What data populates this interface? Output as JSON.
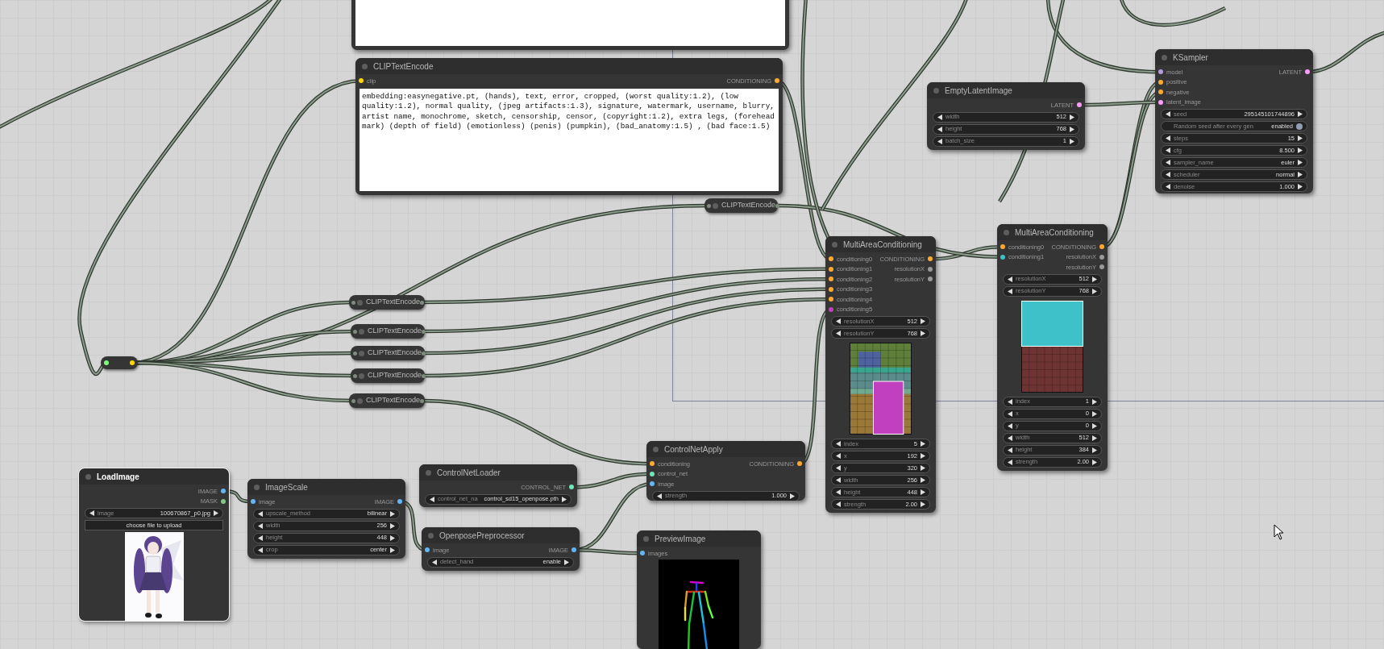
{
  "nodes": [
    {
      "kind": "node",
      "collapsed": false,
      "selected": false,
      "widgets": [
        {
          "kind": "text"
        }
      ]
    },
    {
      "kind": "node",
      "title": "KSampler",
      "collapsed": false,
      "selected": false,
      "inputs": [
        {
          "name": "model",
          "color": "#b39ddb"
        },
        {
          "name": "positive",
          "color": "#ffa931"
        },
        {
          "name": "negative",
          "color": "#ffa931"
        },
        {
          "name": "latent_image",
          "color": "#ff9cf9"
        }
      ],
      "outputs": [
        {
          "name": "LATENT",
          "color": "#ff9cf9"
        }
      ],
      "widgets": [
        {
          "kind": "value",
          "label": "seed",
          "value": "295145101744896"
        },
        {
          "kind": "toggle",
          "label": "Random seed after every gen",
          "value": "enabled",
          "on": true
        },
        {
          "kind": "value",
          "label": "steps",
          "value": "15"
        },
        {
          "kind": "value",
          "label": "cfg",
          "value": "8.500"
        },
        {
          "kind": "value",
          "label": "sampler_name",
          "value": "euler"
        },
        {
          "kind": "value",
          "label": "scheduler",
          "value": "normal"
        },
        {
          "kind": "value",
          "label": "denoise",
          "value": "1.000"
        }
      ]
    },
    {
      "kind": "node",
      "title": "CLIPTextEncode",
      "collapsed": false,
      "selected": false,
      "inputs": [
        {
          "name": "clip",
          "color": "#ffd500"
        }
      ],
      "outputs": [
        {
          "name": "CONDITIONING",
          "color": "#ffa931"
        }
      ],
      "widgets": [
        {
          "kind": "text",
          "value": "embedding:easynegative.pt, (hands), text, error, cropped, (worst quality:1.2), (low quality:1.2), normal quality, (jpeg artifacts:1.3), signature, watermark, username, blurry, artist name, monochrome, sketch, censorship, censor, (copyright:1.2), extra legs, (forehead mark) (depth of field) (emotionless) (penis) (pumpkin), (bad_anatomy:1.5) , (bad face:1.5)"
        }
      ]
    },
    {
      "kind": "node",
      "title": "EmptyLatentImage",
      "collapsed": false,
      "selected": false,
      "outputs": [
        {
          "name": "LATENT",
          "color": "#ff9cf9"
        }
      ],
      "widgets": [
        {
          "kind": "value",
          "label": "width",
          "value": "512"
        },
        {
          "kind": "value",
          "label": "height",
          "value": "768"
        },
        {
          "kind": "value",
          "label": "batch_size",
          "value": "1"
        }
      ]
    },
    {
      "kind": "node",
      "title": "CLIPTextEncode",
      "collapsed": true,
      "selected": false
    },
    {
      "kind": "node",
      "title": "MultiAreaConditioning",
      "collapsed": false,
      "selected": false,
      "inputs": [
        {
          "name": "conditioning0",
          "color": "#ffa931"
        },
        {
          "name": "conditioning1",
          "color": "#3fc1c9"
        }
      ],
      "outputs": [
        {
          "name": "CONDITIONING",
          "color": "#ffa931"
        },
        {
          "name": "resolutionX",
          "color": "#999999"
        },
        {
          "name": "resolutionY",
          "color": "#999999"
        }
      ],
      "widgets": [
        {
          "kind": "value",
          "label": "resolutionX",
          "value": "512"
        },
        {
          "kind": "value",
          "label": "resolutionY",
          "value": "768"
        },
        {
          "kind": "area_preview"
        },
        {
          "kind": "value",
          "label": "index",
          "value": "1"
        },
        {
          "kind": "value",
          "label": "x",
          "value": "0"
        },
        {
          "kind": "value",
          "label": "y",
          "value": "0"
        },
        {
          "kind": "value",
          "label": "width",
          "value": "512"
        },
        {
          "kind": "value",
          "label": "height",
          "value": "384"
        },
        {
          "kind": "value",
          "label": "strength",
          "value": "2.00"
        }
      ]
    },
    {
      "kind": "node",
      "title": "MultiAreaConditioning",
      "collapsed": false,
      "selected": false,
      "inputs": [
        {
          "name": "conditioning0",
          "color": "#ffa931"
        },
        {
          "name": "conditioning1",
          "color": "#ffa931"
        },
        {
          "name": "conditioning2",
          "color": "#ffa931"
        },
        {
          "name": "conditioning3",
          "color": "#ffa931"
        },
        {
          "name": "conditioning4",
          "color": "#ffa931"
        },
        {
          "name": "conditioning5",
          "color": "#c040c0"
        }
      ],
      "outputs": [
        {
          "name": "CONDITIONING",
          "color": "#ffa931"
        },
        {
          "name": "resolutionX",
          "color": "#999999"
        },
        {
          "name": "resolutionY",
          "color": "#999999"
        }
      ],
      "widgets": [
        {
          "kind": "value",
          "label": "resolutionX",
          "value": "512"
        },
        {
          "kind": "value",
          "label": "resolutionY",
          "value": "768"
        },
        {
          "kind": "area_preview"
        },
        {
          "kind": "value",
          "label": "index",
          "value": "5"
        },
        {
          "kind": "value",
          "label": "x",
          "value": "192"
        },
        {
          "kind": "value",
          "label": "y",
          "value": "320"
        },
        {
          "kind": "value",
          "label": "width",
          "value": "256"
        },
        {
          "kind": "value",
          "label": "height",
          "value": "448"
        },
        {
          "kind": "value",
          "label": "strength",
          "value": "2.00"
        }
      ]
    },
    {
      "kind": "node",
      "title": "CLIPTextEncode",
      "collapsed": true,
      "selected": false
    },
    {
      "kind": "node",
      "title": "CLIPTextEncode",
      "collapsed": true,
      "selected": false
    },
    {
      "kind": "node",
      "title": "CLIPTextEncode",
      "collapsed": true,
      "selected": false
    },
    {
      "kind": "node",
      "title": "CLIPTextEncode",
      "collapsed": true,
      "selected": false
    },
    {
      "kind": "node",
      "title": "CLIPTextEncode",
      "collapsed": true,
      "selected": false
    },
    {
      "kind": "reroute",
      "selected": false,
      "inputs": [
        {
          "color": "#7cfc7c"
        }
      ],
      "outputs": [
        {
          "color": "#ffd500"
        }
      ]
    },
    {
      "kind": "node",
      "title": "ControlNetApply",
      "collapsed": false,
      "selected": false,
      "inputs": [
        {
          "name": "conditioning",
          "color": "#ffa931"
        },
        {
          "name": "control_net",
          "color": "#6ee7b7"
        },
        {
          "name": "image",
          "color": "#64b5f6"
        }
      ],
      "outputs": [
        {
          "name": "CONDITIONING",
          "color": "#ffa931"
        }
      ],
      "widgets": [
        {
          "kind": "value",
          "label": "strength",
          "value": "1.000"
        }
      ]
    },
    {
      "kind": "node",
      "title": "ControlNetLoader",
      "collapsed": false,
      "selected": false,
      "outputs": [
        {
          "name": "CONTROL_NET",
          "color": "#6ee7b7"
        }
      ],
      "widgets": [
        {
          "kind": "value",
          "label": "control_net_na",
          "value": "control_sd15_openpose.pth"
        }
      ]
    },
    {
      "kind": "node",
      "title": "LoadImage",
      "collapsed": false,
      "selected": true,
      "outputs": [
        {
          "name": "IMAGE",
          "color": "#64b5f6"
        },
        {
          "name": "MASK",
          "color": "#81c784"
        }
      ],
      "widgets": [
        {
          "kind": "value",
          "label": "image",
          "value": "100670867_p0.jpg"
        },
        {
          "kind": "button",
          "label": "choose file to upload"
        },
        {
          "kind": "picture"
        }
      ]
    },
    {
      "kind": "node",
      "title": "ImageScale",
      "collapsed": false,
      "selected": false,
      "inputs": [
        {
          "name": "image",
          "color": "#64b5f6"
        }
      ],
      "outputs": [
        {
          "name": "IMAGE",
          "color": "#64b5f6"
        }
      ],
      "widgets": [
        {
          "kind": "value",
          "label": "upscale_method",
          "value": "bilinear"
        },
        {
          "kind": "value",
          "label": "width",
          "value": "256"
        },
        {
          "kind": "value",
          "label": "height",
          "value": "448"
        },
        {
          "kind": "value",
          "label": "crop",
          "value": "center"
        }
      ]
    },
    {
      "kind": "node",
      "title": "OpenposePreprocessor",
      "collapsed": false,
      "selected": false,
      "inputs": [
        {
          "name": "image",
          "color": "#64b5f6"
        }
      ],
      "outputs": [
        {
          "name": "IMAGE",
          "color": "#64b5f6"
        }
      ],
      "widgets": [
        {
          "kind": "value",
          "label": "detect_hand",
          "value": "enable"
        }
      ]
    },
    {
      "kind": "node",
      "title": "PreviewImage",
      "collapsed": false,
      "selected": false,
      "inputs": [
        {
          "name": "images",
          "color": "#64b5f6"
        }
      ],
      "widgets": [
        {
          "kind": "picture"
        }
      ]
    }
  ]
}
